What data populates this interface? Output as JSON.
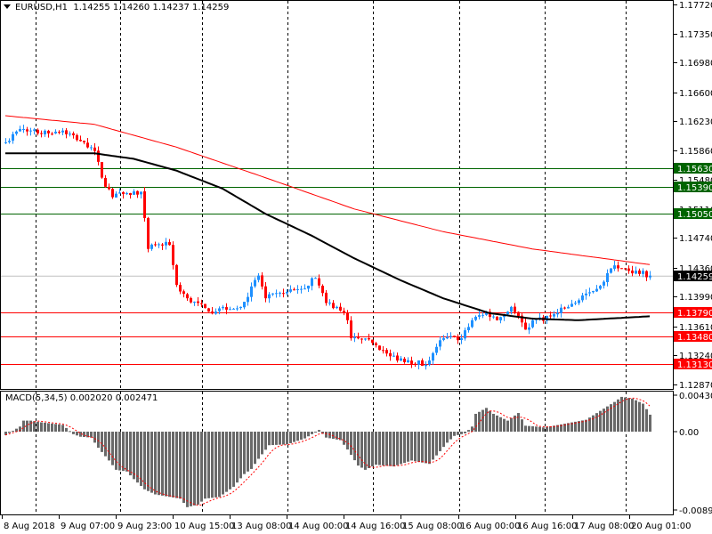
{
  "header": {
    "symbol": "EURUSD,H1",
    "open": "1.14255",
    "high": "1.14260",
    "low": "1.14237",
    "close": "1.14259"
  },
  "macd": {
    "label": "MACD(5,34,5)",
    "main": "0.002020",
    "signal": "0.002471",
    "axis_top": "0.004304",
    "axis_zero": "0.00",
    "axis_bottom": "-0.008953"
  },
  "colors": {
    "bull": "#1e90ff",
    "bear": "#ff0000",
    "ma_slow": "#ff0000",
    "ma_fast": "#000000",
    "support_resistance_green": "#006400",
    "support_resistance_red": "#ff0000",
    "histogram": "#696969",
    "signal": "#ff0000"
  },
  "price_axis": [
    "1.17720",
    "1.17350",
    "1.16980",
    "1.16600",
    "1.16230",
    "1.15860",
    "1.15480",
    "1.15110",
    "1.14740",
    "1.14360",
    "1.13990",
    "1.13610",
    "1.13240",
    "1.12870"
  ],
  "levels": [
    {
      "price": "1.15630",
      "color": "green"
    },
    {
      "price": "1.15390",
      "color": "green"
    },
    {
      "price": "1.15050",
      "color": "green"
    },
    {
      "price": "1.13790",
      "color": "red"
    },
    {
      "price": "1.13480",
      "color": "red"
    },
    {
      "price": "1.13130",
      "color": "red"
    }
  ],
  "current_price": "1.14259",
  "time_axis": [
    "8 Aug 2018",
    "9 Aug 07:00",
    "9 Aug 23:00",
    "10 Aug 15:00",
    "13 Aug 08:00",
    "14 Aug 00:00",
    "14 Aug 16:00",
    "15 Aug 08:00",
    "16 Aug 00:00",
    "16 Aug 16:00",
    "17 Aug 08:00",
    "20 Aug 01:00"
  ],
  "chart_data": {
    "type": "candlestick",
    "bars": 182,
    "price_range": [
      1.1287,
      1.1772
    ],
    "close_keypoints": [
      [
        0,
        1.1596
      ],
      [
        4,
        1.1613
      ],
      [
        6,
        1.161
      ],
      [
        13,
        1.1607
      ],
      [
        16,
        1.1611
      ],
      [
        22,
        1.1596
      ],
      [
        25,
        1.1585
      ],
      [
        27,
        1.1551
      ],
      [
        30,
        1.1526
      ],
      [
        33,
        1.153
      ],
      [
        38,
        1.1533
      ],
      [
        40,
        1.146
      ],
      [
        42,
        1.1465
      ],
      [
        46,
        1.1465
      ],
      [
        48,
        1.1414
      ],
      [
        51,
        1.1397
      ],
      [
        57,
        1.138
      ],
      [
        61,
        1.1386
      ],
      [
        66,
        1.1386
      ],
      [
        71,
        1.1426
      ],
      [
        73,
        1.1397
      ],
      [
        78,
        1.1403
      ],
      [
        83,
        1.1409
      ],
      [
        87,
        1.1423
      ],
      [
        90,
        1.1391
      ],
      [
        93,
        1.1386
      ],
      [
        96,
        1.1369
      ],
      [
        97,
        1.1346
      ],
      [
        103,
        1.134
      ],
      [
        108,
        1.1323
      ],
      [
        113,
        1.1318
      ],
      [
        118,
        1.1312
      ],
      [
        121,
        1.1335
      ],
      [
        123,
        1.1346
      ],
      [
        128,
        1.1346
      ],
      [
        131,
        1.1369
      ],
      [
        135,
        1.138
      ],
      [
        138,
        1.1369
      ],
      [
        142,
        1.1386
      ],
      [
        146,
        1.1357
      ],
      [
        148,
        1.1369
      ],
      [
        153,
        1.1374
      ],
      [
        158,
        1.1386
      ],
      [
        163,
        1.1403
      ],
      [
        166,
        1.1409
      ],
      [
        171,
        1.1439
      ],
      [
        173,
        1.1435
      ],
      [
        181,
        1.14259
      ]
    ],
    "ma_slow_keypoints": [
      [
        0,
        1.163
      ],
      [
        25,
        1.1619
      ],
      [
        48,
        1.159
      ],
      [
        73,
        1.1551
      ],
      [
        98,
        1.1511
      ],
      [
        123,
        1.1482
      ],
      [
        148,
        1.146
      ],
      [
        181,
        1.144
      ]
    ],
    "ma_fast_keypoints": [
      [
        0,
        1.1582
      ],
      [
        25,
        1.1582
      ],
      [
        36,
        1.1575
      ],
      [
        48,
        1.156
      ],
      [
        61,
        1.1537
      ],
      [
        73,
        1.1505
      ],
      [
        86,
        1.1477
      ],
      [
        98,
        1.1448
      ],
      [
        111,
        1.142
      ],
      [
        123,
        1.1397
      ],
      [
        136,
        1.1378
      ],
      [
        148,
        1.1371
      ],
      [
        161,
        1.1369
      ],
      [
        181,
        1.1374
      ]
    ],
    "macd_range": [
      -0.008953,
      0.004304
    ],
    "macd_keypoints": [
      [
        0,
        -0.0004
      ],
      [
        4,
        0.0006
      ],
      [
        5,
        0.0013
      ],
      [
        7,
        0.0013
      ],
      [
        10,
        0.0011
      ],
      [
        14,
        0.0009
      ],
      [
        16,
        0.0008
      ],
      [
        19,
        -0.0003
      ],
      [
        21,
        -0.0006
      ],
      [
        24,
        -0.0007
      ],
      [
        26,
        -0.0019
      ],
      [
        29,
        -0.0034
      ],
      [
        31,
        -0.0045
      ],
      [
        34,
        -0.0047
      ],
      [
        36,
        -0.0056
      ],
      [
        39,
        -0.0068
      ],
      [
        42,
        -0.0074
      ],
      [
        49,
        -0.0079
      ],
      [
        51,
        -0.0089
      ],
      [
        54,
        -0.0086
      ],
      [
        56,
        -0.0079
      ],
      [
        60,
        -0.0077
      ],
      [
        64,
        -0.0065
      ],
      [
        67,
        -0.005
      ],
      [
        69,
        -0.0044
      ],
      [
        71,
        -0.0032
      ],
      [
        74,
        -0.0016
      ],
      [
        79,
        -0.0015
      ],
      [
        84,
        -0.0008
      ],
      [
        88,
        0.0002
      ],
      [
        90,
        -0.0007
      ],
      [
        94,
        -0.001
      ],
      [
        96,
        -0.0021
      ],
      [
        99,
        -0.004
      ],
      [
        101,
        -0.0045
      ],
      [
        104,
        -0.0039
      ],
      [
        109,
        -0.0041
      ],
      [
        114,
        -0.0034
      ],
      [
        119,
        -0.0038
      ],
      [
        121,
        -0.0028
      ],
      [
        124,
        -0.0013
      ],
      [
        126,
        -0.0005
      ],
      [
        129,
        -0.0002
      ],
      [
        131,
        0.0006
      ],
      [
        132,
        0.0021
      ],
      [
        135,
        0.0028
      ],
      [
        137,
        0.0021
      ],
      [
        141,
        0.0013
      ],
      [
        144,
        0.0022
      ],
      [
        146,
        0.0007
      ],
      [
        149,
        0.0006
      ],
      [
        151,
        0.0005
      ],
      [
        154,
        0.0007
      ],
      [
        163,
        0.0014
      ],
      [
        171,
        0.0035
      ],
      [
        173,
        0.0041
      ],
      [
        176,
        0.0039
      ],
      [
        179,
        0.0033
      ],
      [
        181,
        0.002
      ]
    ]
  }
}
